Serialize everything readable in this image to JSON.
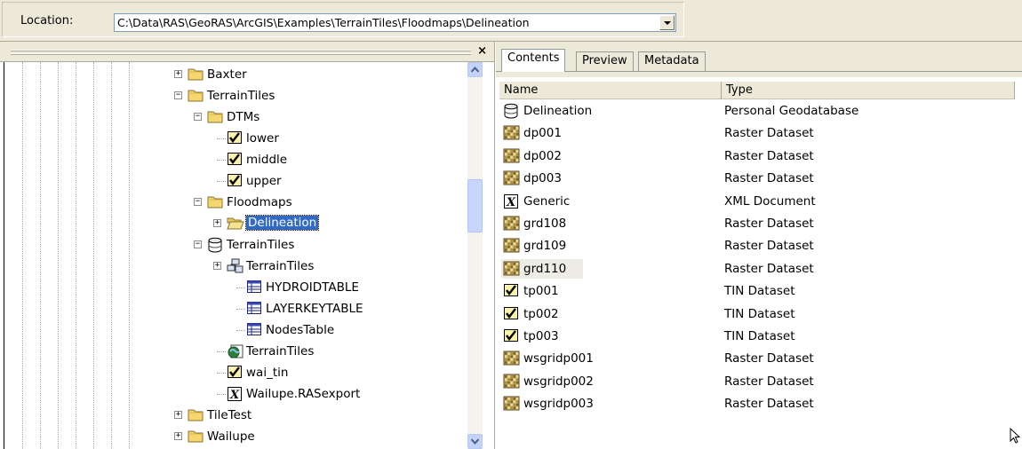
{
  "location": {
    "label": "Location:",
    "path": "C:\\Data\\RAS\\GeoRAS\\ArcGIS\\Examples\\TerrainTiles\\Floodmaps\\Delineation"
  },
  "tree": {
    "close_label": "×",
    "items": [
      {
        "label": "Baxter",
        "icon": "folder-icon",
        "expander": "+"
      },
      {
        "label": "TerrainTiles",
        "icon": "folder-icon",
        "expander": "−"
      },
      {
        "label": "DTMs",
        "icon": "folder-icon",
        "expander": "−"
      },
      {
        "label": "lower",
        "icon": "tin-icon",
        "expander": ""
      },
      {
        "label": "middle",
        "icon": "tin-icon",
        "expander": ""
      },
      {
        "label": "upper",
        "icon": "tin-icon",
        "expander": ""
      },
      {
        "label": "Floodmaps",
        "icon": "folder-icon",
        "expander": "−"
      },
      {
        "label": "Delineation",
        "icon": "open-folder-icon",
        "expander": "+"
      },
      {
        "label": "TerrainTiles",
        "icon": "geodatabase-icon",
        "expander": "−"
      },
      {
        "label": "TerrainTiles",
        "icon": "feature-dataset-icon",
        "expander": "+"
      },
      {
        "label": "HYDROIDTABLE",
        "icon": "table-icon",
        "expander": ""
      },
      {
        "label": "LAYERKEYTABLE",
        "icon": "table-icon",
        "expander": ""
      },
      {
        "label": "NodesTable",
        "icon": "table-icon",
        "expander": ""
      },
      {
        "label": "TerrainTiles",
        "icon": "map-document-icon",
        "expander": ""
      },
      {
        "label": "wai_tin",
        "icon": "tin-icon",
        "expander": ""
      },
      {
        "label": "Wailupe.RASexport",
        "icon": "xml-icon",
        "expander": ""
      },
      {
        "label": "TileTest",
        "icon": "folder-icon",
        "expander": "+"
      },
      {
        "label": "Wailupe",
        "icon": "folder-icon",
        "expander": "+"
      }
    ]
  },
  "tabs": [
    "Contents",
    "Preview",
    "Metadata"
  ],
  "columns": [
    "Name",
    "Type"
  ],
  "contents": [
    {
      "name": "Delineation",
      "type": "Personal Geodatabase",
      "icon": "geodatabase-icon"
    },
    {
      "name": "dp001",
      "type": "Raster Dataset",
      "icon": "raster-icon"
    },
    {
      "name": "dp002",
      "type": "Raster Dataset",
      "icon": "raster-icon"
    },
    {
      "name": "dp003",
      "type": "Raster Dataset",
      "icon": "raster-icon"
    },
    {
      "name": "Generic",
      "type": "XML Document",
      "icon": "xml-icon"
    },
    {
      "name": "grd108",
      "type": "Raster Dataset",
      "icon": "raster-icon"
    },
    {
      "name": "grd109",
      "type": "Raster Dataset",
      "icon": "raster-icon"
    },
    {
      "name": "grd110",
      "type": "Raster Dataset",
      "icon": "raster-icon"
    },
    {
      "name": "tp001",
      "type": "TIN Dataset",
      "icon": "tin-icon"
    },
    {
      "name": "tp002",
      "type": "TIN Dataset",
      "icon": "tin-icon"
    },
    {
      "name": "tp003",
      "type": "TIN Dataset",
      "icon": "tin-icon"
    },
    {
      "name": "wsgridp001",
      "type": "Raster Dataset",
      "icon": "raster-icon"
    },
    {
      "name": "wsgridp002",
      "type": "Raster Dataset",
      "icon": "raster-icon"
    },
    {
      "name": "wsgridp003",
      "type": "Raster Dataset",
      "icon": "raster-icon"
    }
  ],
  "colors": {
    "selection": "#316ac5",
    "chrome": "#ece9d8",
    "folder": "#f5d76e"
  }
}
